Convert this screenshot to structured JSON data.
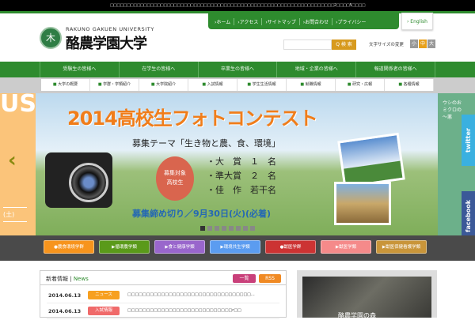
{
  "top_notice": "□□□□□□□□□□□□□□□□□□□□□□□□□□□□□□□□□□□□□□□□□□□□□□□□□□□□□□□□□□□□□□□□□□□2□□□□5□□□□",
  "logo": {
    "en": "RAKUNO GAKUEN UNIVERSITY",
    "ja": "酪農学園大学",
    "emblem": "木"
  },
  "util_nav": [
    "›ホーム",
    "›アクセス",
    "›サイトマップ",
    "›お問合わせ",
    "›プライバシー"
  ],
  "english": "› English",
  "search": {
    "placeholder": "",
    "button": "Q 検 索"
  },
  "font_size": {
    "label": "文字サイズの変更",
    "small": "小",
    "medium": "中",
    "large": "大"
  },
  "main_nav": [
    "受験生の皆様へ",
    "在学生の皆様へ",
    "卒業生の皆様へ",
    "地域・企業の皆様へ",
    "報道関係者の皆様へ"
  ],
  "sub_nav": [
    "大学の概要",
    "学群・学類紹介",
    "大学院紹介",
    "入試情報",
    "学生生活情報",
    "就職情報",
    "研究・広報",
    "各種情報"
  ],
  "banner": {
    "left": {
      "big": "US",
      "date": "(土)"
    },
    "title": "2014高校生フォトコンテスト",
    "theme": "募集テーマ「生き物と農、食、環境」",
    "target": [
      "募集対象",
      "高校生"
    ],
    "prizes": "・大　賞　１　名\n・準大賞　２　名\n・佳　作　若干名",
    "deadline": "募集締め切り／9月30日(火)(必着)",
    "right_text": "ウシのお\nミクロの\n〜悪",
    "slide_count": 8,
    "active_slide": 1
  },
  "social": {
    "twitter": "twitter",
    "facebook": "facebook"
  },
  "categories": [
    {
      "label": "●農食環境学群",
      "color": "#f7941d"
    },
    {
      "label": "▶循環農学類",
      "color": "#5a9a1a"
    },
    {
      "label": "▶食と健康学類",
      "color": "#9966cc"
    },
    {
      "label": "▶環境共生学類",
      "color": "#5b9cf0"
    },
    {
      "label": "●獣医学群",
      "color": "#cc3333"
    },
    {
      "label": "▶獣医学類",
      "color": "#f58a8a"
    },
    {
      "label": "▶獣医保健看護学類",
      "color": "#c9953a"
    }
  ],
  "news": {
    "title": "新着情報",
    "title_en": "News",
    "list_button": "一覧",
    "rss_button": "RSS",
    "items": [
      {
        "date": "2014.06.13",
        "tag": "ニュース",
        "tag_color": "#f7a020",
        "text": "□□□□□□□□□□□□□□□□□□□□□□□□□□□□□□□□□..."
      },
      {
        "date": "2014.06.13",
        "tag": "入試情報",
        "tag_color": "#f06a6a",
        "text": "□□□□□□□□□□□□□□□□□□□□□□□□□□□□r□□"
      }
    ]
  },
  "side": {
    "caption": "酪農学園の森"
  }
}
